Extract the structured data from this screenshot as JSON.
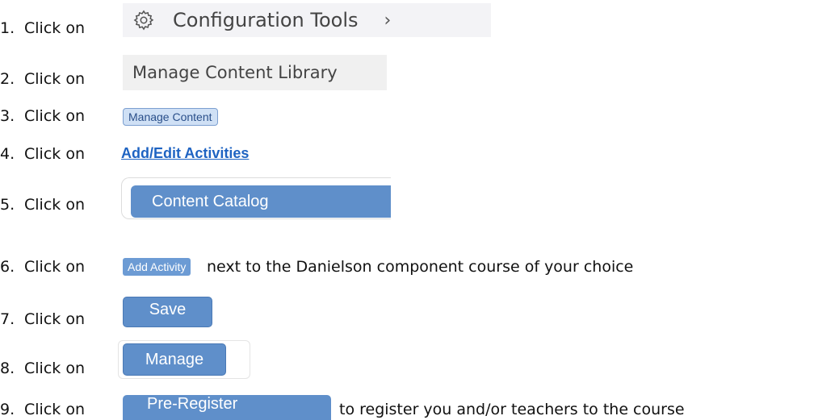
{
  "steps": [
    {
      "num": "1.",
      "text": "Click on"
    },
    {
      "num": "2.",
      "text": "Click on"
    },
    {
      "num": "3.",
      "text": "Click on"
    },
    {
      "num": "4.",
      "text": "Click on"
    },
    {
      "num": "5.",
      "text": "Click on"
    },
    {
      "num": "6.",
      "text": "Click on",
      "after": "next to the Danielson component course of your choice"
    },
    {
      "num": "7.",
      "text": "Click on"
    },
    {
      "num": "8.",
      "text": "Click on"
    },
    {
      "num": "9.",
      "text": "Click on",
      "after": "to register you and/or teachers to the course"
    }
  ],
  "ui": {
    "config_tools": "Configuration Tools",
    "config_chevron": "›",
    "manage_content_library": "Manage Content Library",
    "manage_content": "Manage Content",
    "add_edit_activities": "Add/Edit Activities",
    "content_catalog": "Content Catalog",
    "add_activity": "Add Activity",
    "save": "Save",
    "manage": "Manage",
    "pre_register": "Pre-Register"
  },
  "colors": {
    "button_blue": "#5f8fca",
    "link_blue": "#1e63c2"
  }
}
